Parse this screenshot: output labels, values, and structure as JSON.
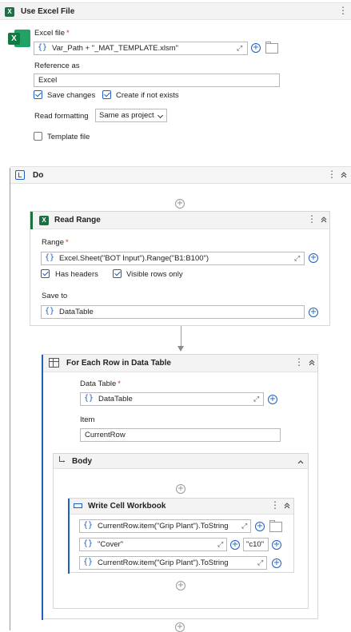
{
  "use_excel": {
    "title": "Use Excel File",
    "file_label": "Excel file",
    "required_mark": "*",
    "file_expr": "Var_Path + \"_MAT_TEMPLATE.xlsm\"",
    "brace": "{}",
    "reference_label": "Reference as",
    "reference_value": "Excel",
    "save_changes_label": "Save changes",
    "create_label": "Create if not exists",
    "read_formatting_label": "Read formatting",
    "read_formatting_value": "Same as project",
    "template_label": "Template file"
  },
  "do": {
    "title": "Do"
  },
  "read_range": {
    "title": "Read Range",
    "range_label": "Range",
    "range_expr": "Excel.Sheet(\"BOT Input\").Range(\"B1:B100\")",
    "has_headers_label": "Has headers",
    "visible_rows_label": "Visible rows only",
    "save_to_label": "Save to",
    "save_to_expr": "DataTable"
  },
  "for_each": {
    "title": "For Each Row in Data Table",
    "data_table_label": "Data Table",
    "data_table_expr": "DataTable",
    "item_label": "Item",
    "item_value": "CurrentRow"
  },
  "body": {
    "title": "Body"
  },
  "write_cell": {
    "title": "Write Cell Workbook",
    "path_expr": "CurrentRow.item(\"Grip Plant\").ToString",
    "sheet_expr": "\"Cover\"",
    "cell_expr": "\"c10\"",
    "value_expr": "CurrentRow.item(\"Grip Plant\").ToString"
  },
  "colors": {
    "accent": "#1f5fbf",
    "excel_green": "#1d7044",
    "header_bg": "#f3f3f3"
  }
}
